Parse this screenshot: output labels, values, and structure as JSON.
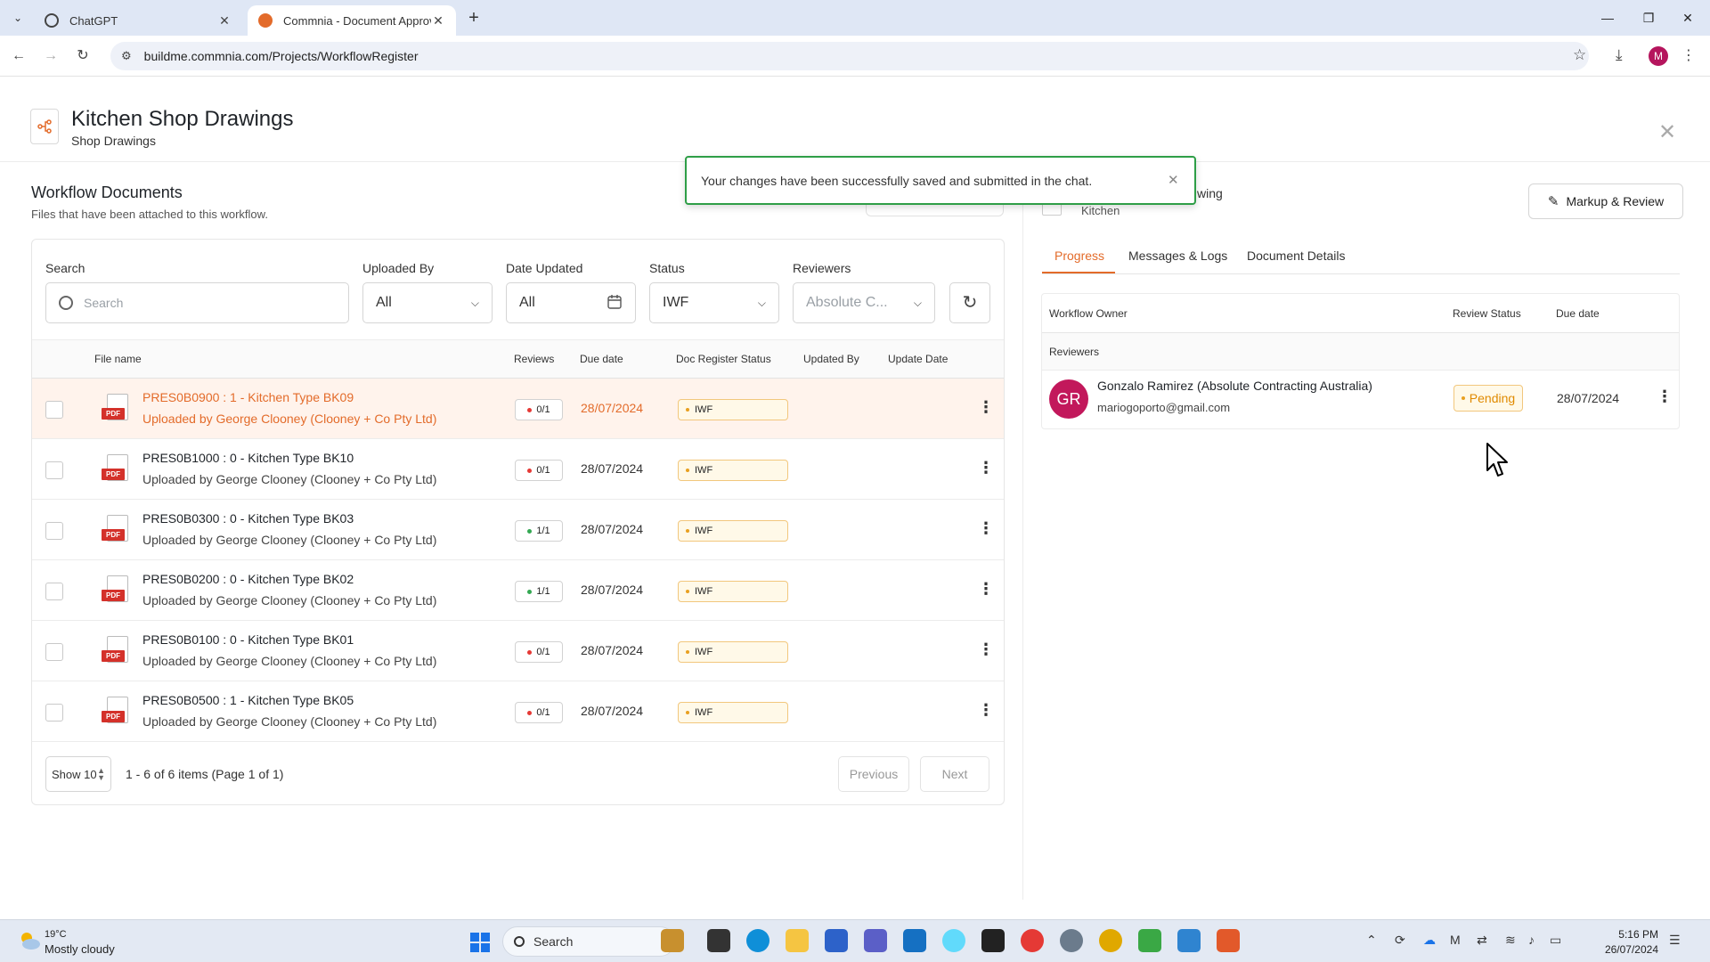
{
  "browser": {
    "tabs": [
      {
        "title": "ChatGPT",
        "active": false
      },
      {
        "title": "Commnia - Document Approva",
        "active": true
      }
    ],
    "url": "buildme.commnia.com/Projects/WorkflowRegister",
    "profile_initial": "M"
  },
  "header": {
    "title": "Kitchen Shop Drawings",
    "subtitle": "Shop Drawings"
  },
  "toast": {
    "message": "Your changes have been successfully saved and submitted in the chat."
  },
  "workflow": {
    "title": "Workflow Documents",
    "subtitle": "Files that have been attached to this workflow."
  },
  "filters": {
    "search_label": "Search",
    "search_placeholder": "Search",
    "uploaded_by_label": "Uploaded By",
    "uploaded_by_value": "All",
    "date_updated_label": "Date Updated",
    "date_updated_value": "All",
    "status_label": "Status",
    "status_value": "IWF",
    "reviewers_label": "Reviewers",
    "reviewers_value": "Absolute C..."
  },
  "table": {
    "columns": {
      "file_name": "File name",
      "reviews": "Reviews",
      "due_date": "Due date",
      "doc_status": "Doc Register Status",
      "updated_by": "Updated By",
      "update_date": "Update Date"
    },
    "rows": [
      {
        "name": "PRES0B0900 : 1 - Kitchen Type BK09",
        "uploaded": "Uploaded by George Clooney (Clooney + Co Pty Ltd)",
        "reviews": "0/1",
        "review_color": "#e53935",
        "due": "28/07/2024",
        "status": "IWF",
        "selected": true
      },
      {
        "name": "PRES0B1000 : 0 - Kitchen Type BK10",
        "uploaded": "Uploaded by George Clooney (Clooney + Co Pty Ltd)",
        "reviews": "0/1",
        "review_color": "#e53935",
        "due": "28/07/2024",
        "status": "IWF",
        "selected": false
      },
      {
        "name": "PRES0B0300 : 0 - Kitchen Type BK03",
        "uploaded": "Uploaded by George Clooney (Clooney + Co Pty Ltd)",
        "reviews": "1/1",
        "review_color": "#34a853",
        "due": "28/07/2024",
        "status": "IWF",
        "selected": false
      },
      {
        "name": "PRES0B0200 : 0 - Kitchen Type BK02",
        "uploaded": "Uploaded by George Clooney (Clooney + Co Pty Ltd)",
        "reviews": "1/1",
        "review_color": "#34a853",
        "due": "28/07/2024",
        "status": "IWF",
        "selected": false
      },
      {
        "name": "PRES0B0100 : 0 - Kitchen Type BK01",
        "uploaded": "Uploaded by George Clooney (Clooney + Co Pty Ltd)",
        "reviews": "0/1",
        "review_color": "#e53935",
        "due": "28/07/2024",
        "status": "IWF",
        "selected": false
      },
      {
        "name": "PRES0B0500 : 1 - Kitchen Type BK05",
        "uploaded": "Uploaded by George Clooney (Clooney + Co Pty Ltd)",
        "reviews": "0/1",
        "review_color": "#e53935",
        "due": "28/07/2024",
        "status": "IWF",
        "selected": false
      }
    ]
  },
  "pagination": {
    "page_size": "Show 10",
    "info": "1 - 6 of 6 items (Page 1 of 1)",
    "previous": "Previous",
    "next": "Next"
  },
  "detail": {
    "doc_name_tail": "wing",
    "doc_kind": "Kitchen",
    "markup_button": "Markup & Review",
    "tabs": [
      "Progress",
      "Messages & Logs",
      "Document Details"
    ],
    "columns": {
      "owner": "Workflow Owner",
      "review_status": "Review Status",
      "due_date": "Due date"
    },
    "group_label": "Reviewers",
    "reviewer": {
      "initials": "GR",
      "name": "Gonzalo Ramirez (Absolute Contracting Australia)",
      "email": "mariogoporto@gmail.com",
      "status": "Pending",
      "due": "28/07/2024"
    }
  },
  "taskbar": {
    "temperature": "19°C",
    "weather": "Mostly cloudy",
    "search": "Search",
    "time": "5:16 PM",
    "date": "26/07/2024"
  },
  "colors": {
    "accent": "#e36b2a",
    "toast_border": "#2e9e47",
    "avatar": "#c2185b"
  }
}
